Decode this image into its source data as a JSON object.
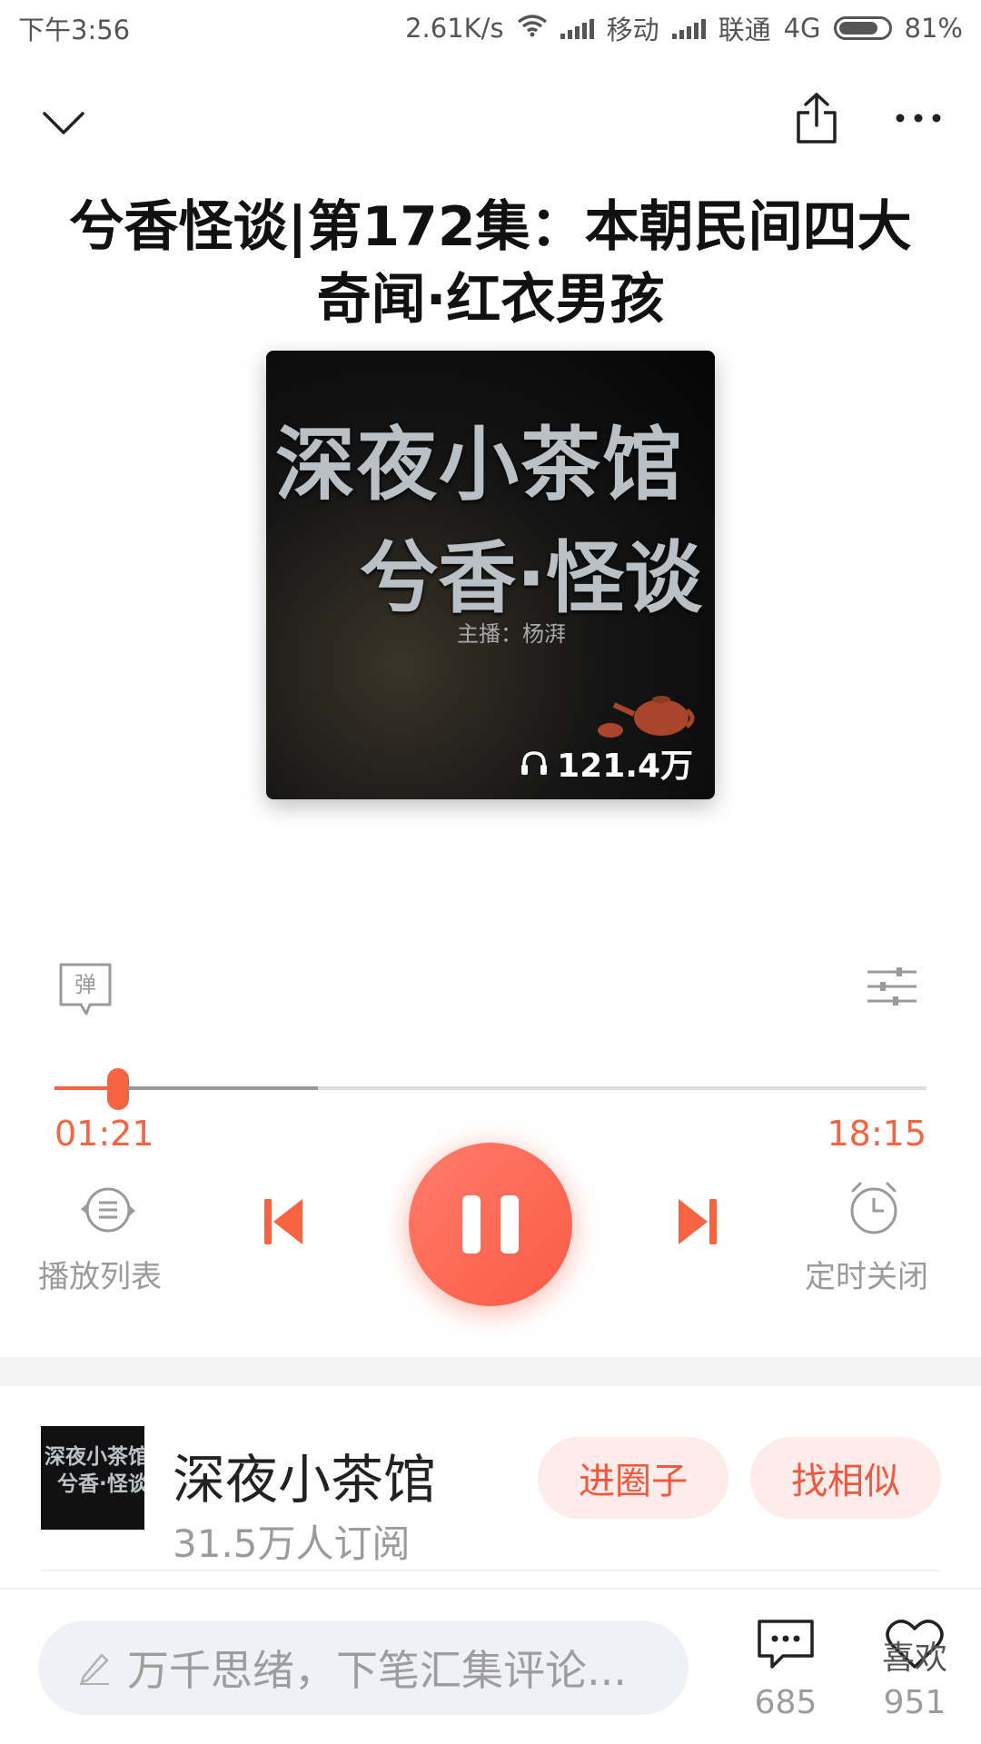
{
  "status_bar": {
    "time": "下午3:56",
    "speed": "2.61K/s",
    "carrier1": "移动",
    "carrier2": "联通",
    "network": "4G",
    "battery": "81%"
  },
  "episode": {
    "title": "兮香怪谈|第172集：本朝民间四大奇闻·红衣男孩"
  },
  "cover": {
    "line1": "深夜小茶馆",
    "line2": "兮香·怪谈",
    "host": "主播：杨湃",
    "plays": "121.4万"
  },
  "player": {
    "danmaku_label": "弹",
    "current_time": "01:21",
    "total_time": "18:15",
    "progress_fraction": 0.074,
    "playlist_label": "播放列表",
    "timer_label": "定时关闭",
    "accent_color": "#f86442"
  },
  "channel": {
    "name": "深夜小茶馆",
    "subscribers": "31.5万人订阅",
    "join_label": "进圈子",
    "similar_label": "找相似",
    "thumb_line1": "深夜小茶馆",
    "thumb_line2": "兮香·怪谈"
  },
  "bottom": {
    "comment_placeholder": "万千思绪，下笔汇集评论...",
    "comment_count": "685",
    "like_label": "喜欢",
    "like_count": "951"
  }
}
